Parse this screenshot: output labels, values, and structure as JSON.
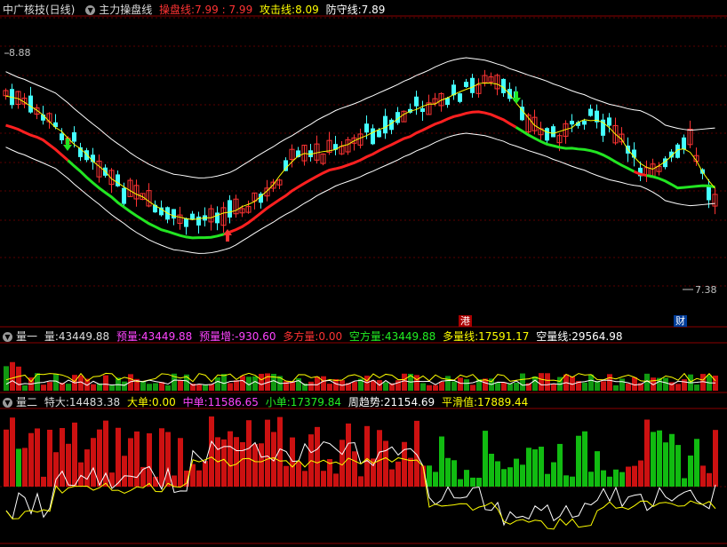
{
  "panel_main": {
    "title": "中广核技(日线)",
    "indicator": "主力操盘线",
    "line1_label": "操盘线:",
    "line1_values": "7.99 : 7.99",
    "line2_label": "攻击线:",
    "line2_value": "8.09",
    "line3_label": "防守线:",
    "line3_value": "7.89",
    "high_label": "8.88",
    "low_label": "7.38",
    "mark_hk": "港",
    "mark_fin": "财",
    "colors": {
      "up": "#ff3333",
      "down": "#44ffff",
      "red_line": "#ff2020",
      "green_line": "#22e522",
      "white_line": "#ffffff",
      "yellow_line": "#ffff00"
    }
  },
  "panel_vol1": {
    "name": "量一",
    "f1_label": "量:",
    "f1_value": "43449.88",
    "f2_label": "预量:",
    "f2_value": "43449.88",
    "f3_label": "预量增:",
    "f3_value": "-930.60",
    "f4_label": "多方量:",
    "f4_value": "0.00",
    "f5_label": "空方量:",
    "f5_value": "43449.88",
    "f6_label": "多量线:",
    "f6_value": "17591.17",
    "f7_label": "空量线:",
    "f7_value": "29564.98"
  },
  "panel_vol2": {
    "name": "量二",
    "f1_label": "特大:",
    "f1_value": "14483.38",
    "f2_label": "大单:",
    "f2_value": "0.00",
    "f3_label": "中单:",
    "f3_value": "11586.65",
    "f4_label": "小单:",
    "f4_value": "17379.84",
    "f5_label": "周趋势:",
    "f5_value": "21154.69",
    "f6_label": "平滑值:",
    "f6_value": "17889.44"
  }
}
